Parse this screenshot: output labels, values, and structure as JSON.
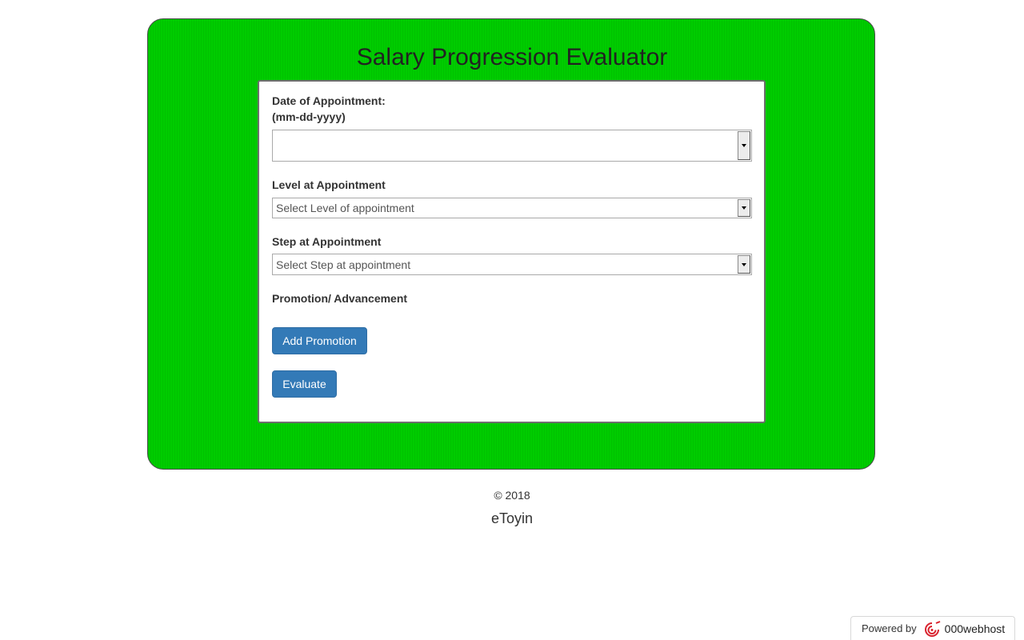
{
  "page": {
    "title": "Salary Progression Evaluator"
  },
  "form": {
    "date_label": "Date of Appointment:",
    "date_format": "(mm-dd-yyyy)",
    "date_value": "",
    "level_label": "Level at Appointment",
    "level_selected": "Select Level of appointment",
    "step_label": "Step at Appointment",
    "step_selected": "Select Step at appointment",
    "promotion_heading": "Promotion/ Advancement",
    "add_promotion_label": "Add Promotion",
    "evaluate_label": "Evaluate"
  },
  "footer": {
    "copyright": "© 2018",
    "author": "eToyin"
  },
  "badge": {
    "powered_by": "Powered by",
    "host_name": "000webhost"
  },
  "colors": {
    "panel_green": "#00cc00",
    "button_blue": "#337ab7",
    "logo_red": "#d9232e"
  }
}
